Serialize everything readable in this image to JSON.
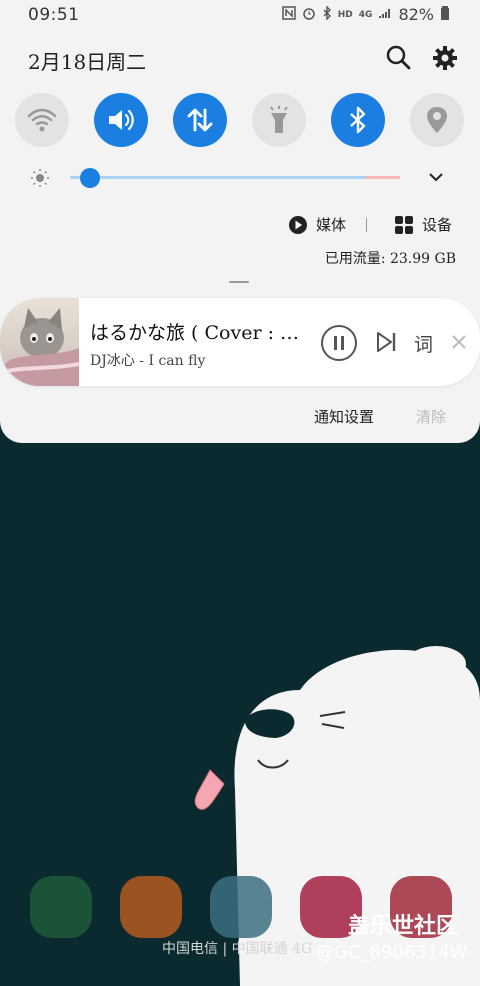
{
  "status_bar": {
    "time": "09:51",
    "battery": "82%",
    "icons": [
      "nfc-icon",
      "alarm-icon",
      "bluetooth-icon",
      "hd-icon",
      "4g-icon",
      "signal-icon",
      "battery-icon"
    ]
  },
  "header": {
    "date": "2月18日周二",
    "search_icon": "search-icon",
    "settings_icon": "gear-icon"
  },
  "quick_tiles": [
    {
      "name": "wifi",
      "icon": "wifi-icon",
      "active": false
    },
    {
      "name": "sound",
      "icon": "volume-icon",
      "active": true
    },
    {
      "name": "mobile-data",
      "icon": "data-arrows-icon",
      "active": true
    },
    {
      "name": "flashlight",
      "icon": "flashlight-icon",
      "active": false
    },
    {
      "name": "bluetooth",
      "icon": "bluetooth-icon",
      "active": true
    },
    {
      "name": "location",
      "icon": "location-icon",
      "active": false
    }
  ],
  "brightness": {
    "level": 0.05
  },
  "controls": {
    "media_label": "媒体",
    "devices_label": "设备"
  },
  "data_usage": "已用流量: 23.99 GB",
  "media_card": {
    "title": "はるかな旅 ( Cover : 吉...",
    "artist": "DJ冰心 - I can fly",
    "lyrics_label": "词"
  },
  "notification_actions": {
    "settings": "通知设置",
    "clear": "清除"
  },
  "home": {
    "carrier": "中国电信 | 中国联通 4G",
    "watermark_1": "盖乐世社区",
    "watermark_2": "@GC_8906314W"
  },
  "colors": {
    "accent": "#1a7fe0",
    "panel": "#f3f3f3",
    "wallpaper": "#0b2a30"
  }
}
